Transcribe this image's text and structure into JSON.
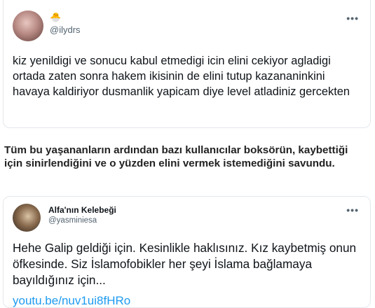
{
  "tweet1": {
    "emoji": "🐣",
    "handle": "@ilydrs",
    "more_icon": "•••",
    "text": "kiz yenildigi ve sonucu kabul etmedigi icin elini cekiyor agladigi ortada zaten sonra hakem ikisinin de elini tutup kazananinkini havaya kaldiriyor dusmanlik yapicam diye level atladiniz gercekten"
  },
  "article": {
    "text": "Tüm bu yaşananların ardından bazı kullanıcılar boksörün, kaybettiği için sinirlendiğini ve o yüzden elini vermek istemediğini savundu."
  },
  "tweet2": {
    "name": "Alfa'nın Kelebeği",
    "handle": "@yasminiesa",
    "more_icon": "•••",
    "text": "Hehe Galip geldiği için. Kesinlikle haklısınız. Kız kaybetmiş onun öfkesinde. Siz İslamofobikler her şeyi İslama bağlamaya bayıldığınız için...",
    "link": "youtu.be/nuv1ui8fHRo"
  }
}
